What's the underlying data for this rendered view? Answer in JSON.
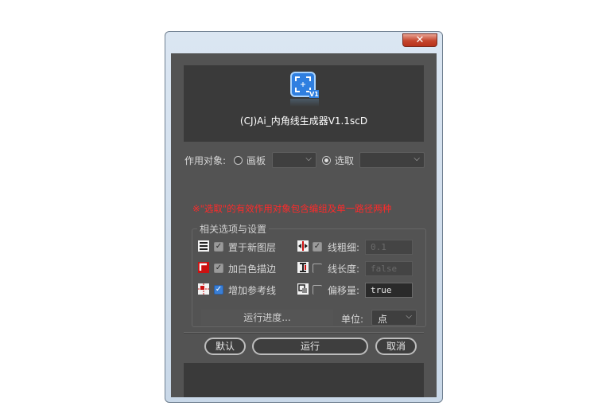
{
  "window": {
    "close_glyph": "✕"
  },
  "header": {
    "logo_icon": "target-frame-icon",
    "logo_badge": "V1",
    "title": "(CJ)Ai_内角线生成器V1.1scD"
  },
  "target": {
    "label": "作用对象:",
    "artboard_label": "画板",
    "artboard_value": "",
    "selection_label": "选取",
    "selection_value": "",
    "selected": "selection"
  },
  "note": "※\"选取\"的有效作用对象包含编组及单一路径两种",
  "options": {
    "group_title": "相关选项与设置",
    "items": [
      {
        "label": "置于新图层",
        "checked": true,
        "icon": "layers-icon"
      },
      {
        "label": "加白色描边",
        "checked": true,
        "icon": "white-stroke-icon"
      },
      {
        "label": "增加参考线",
        "checked": true,
        "icon": "guide-icon"
      }
    ],
    "stroke_weight": {
      "label": "线粗细:",
      "value": "0.1",
      "checked": true,
      "icon": "stroke-weight-icon"
    },
    "line_length": {
      "label": "线长度:",
      "value": "false",
      "checked": false,
      "icon": "line-length-icon"
    },
    "offset": {
      "label": "偏移量:",
      "value": "true",
      "checked": false,
      "icon": "offset-icon"
    },
    "progress_label": "运行进度...",
    "unit_label": "单位:",
    "unit_value": "点"
  },
  "buttons": {
    "default": "默认",
    "run": "运行",
    "cancel": "取消"
  }
}
